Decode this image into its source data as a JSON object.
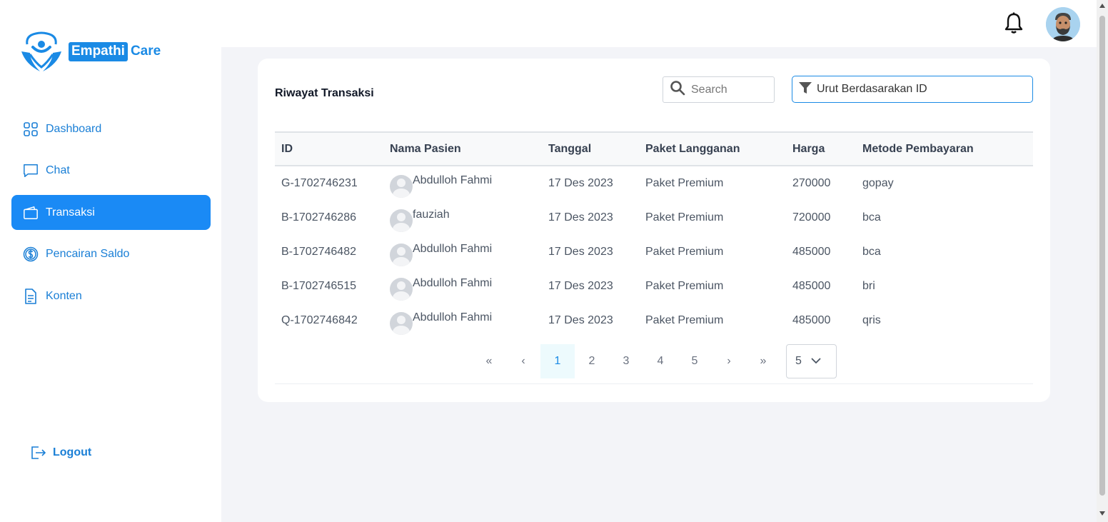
{
  "brand": {
    "name_part1": "Empathi",
    "name_part2": "Care",
    "primary_color": "#1a8ae5"
  },
  "sidebar": {
    "items": [
      {
        "label": "Dashboard",
        "icon": "grid-icon",
        "active": false
      },
      {
        "label": "Chat",
        "icon": "chat-icon",
        "active": false
      },
      {
        "label": "Transaksi",
        "icon": "wallet-icon",
        "active": true
      },
      {
        "label": "Pencairan Saldo",
        "icon": "dollar-coin-icon",
        "active": false
      },
      {
        "label": "Konten",
        "icon": "document-icon",
        "active": false
      }
    ],
    "logout_label": "Logout"
  },
  "header": {
    "notification_icon": "bell-icon",
    "avatar_icon": "user-avatar"
  },
  "transactions": {
    "title": "Riwayat Transaksi",
    "search_placeholder": "Search",
    "sort_label": "Urut Berdasarakan ID",
    "columns": [
      "ID",
      "Nama Pasien",
      "Tanggal",
      "Paket Langganan",
      "Harga",
      "Metode Pembayaran"
    ],
    "rows": [
      {
        "id": "G-1702746231",
        "name": "Abdulloh Fahmi",
        "date": "17 Des 2023",
        "package": "Paket Premium",
        "price": "270000",
        "method": "gopay"
      },
      {
        "id": "B-1702746286",
        "name": "fauziah",
        "date": "17 Des 2023",
        "package": "Paket Premium",
        "price": "720000",
        "method": "bca"
      },
      {
        "id": "B-1702746482",
        "name": "Abdulloh Fahmi",
        "date": "17 Des 2023",
        "package": "Paket Premium",
        "price": "485000",
        "method": "bca"
      },
      {
        "id": "B-1702746515",
        "name": "Abdulloh Fahmi",
        "date": "17 Des 2023",
        "package": "Paket Premium",
        "price": "485000",
        "method": "bri"
      },
      {
        "id": "Q-1702746842",
        "name": "Abdulloh Fahmi",
        "date": "17 Des 2023",
        "package": "Paket Premium",
        "price": "485000",
        "method": "qris"
      }
    ]
  },
  "pagination": {
    "first_label": "«",
    "prev_label": "‹",
    "pages": [
      "1",
      "2",
      "3",
      "4",
      "5"
    ],
    "current_page": "1",
    "next_label": "›",
    "last_label": "»",
    "per_page": "5"
  }
}
